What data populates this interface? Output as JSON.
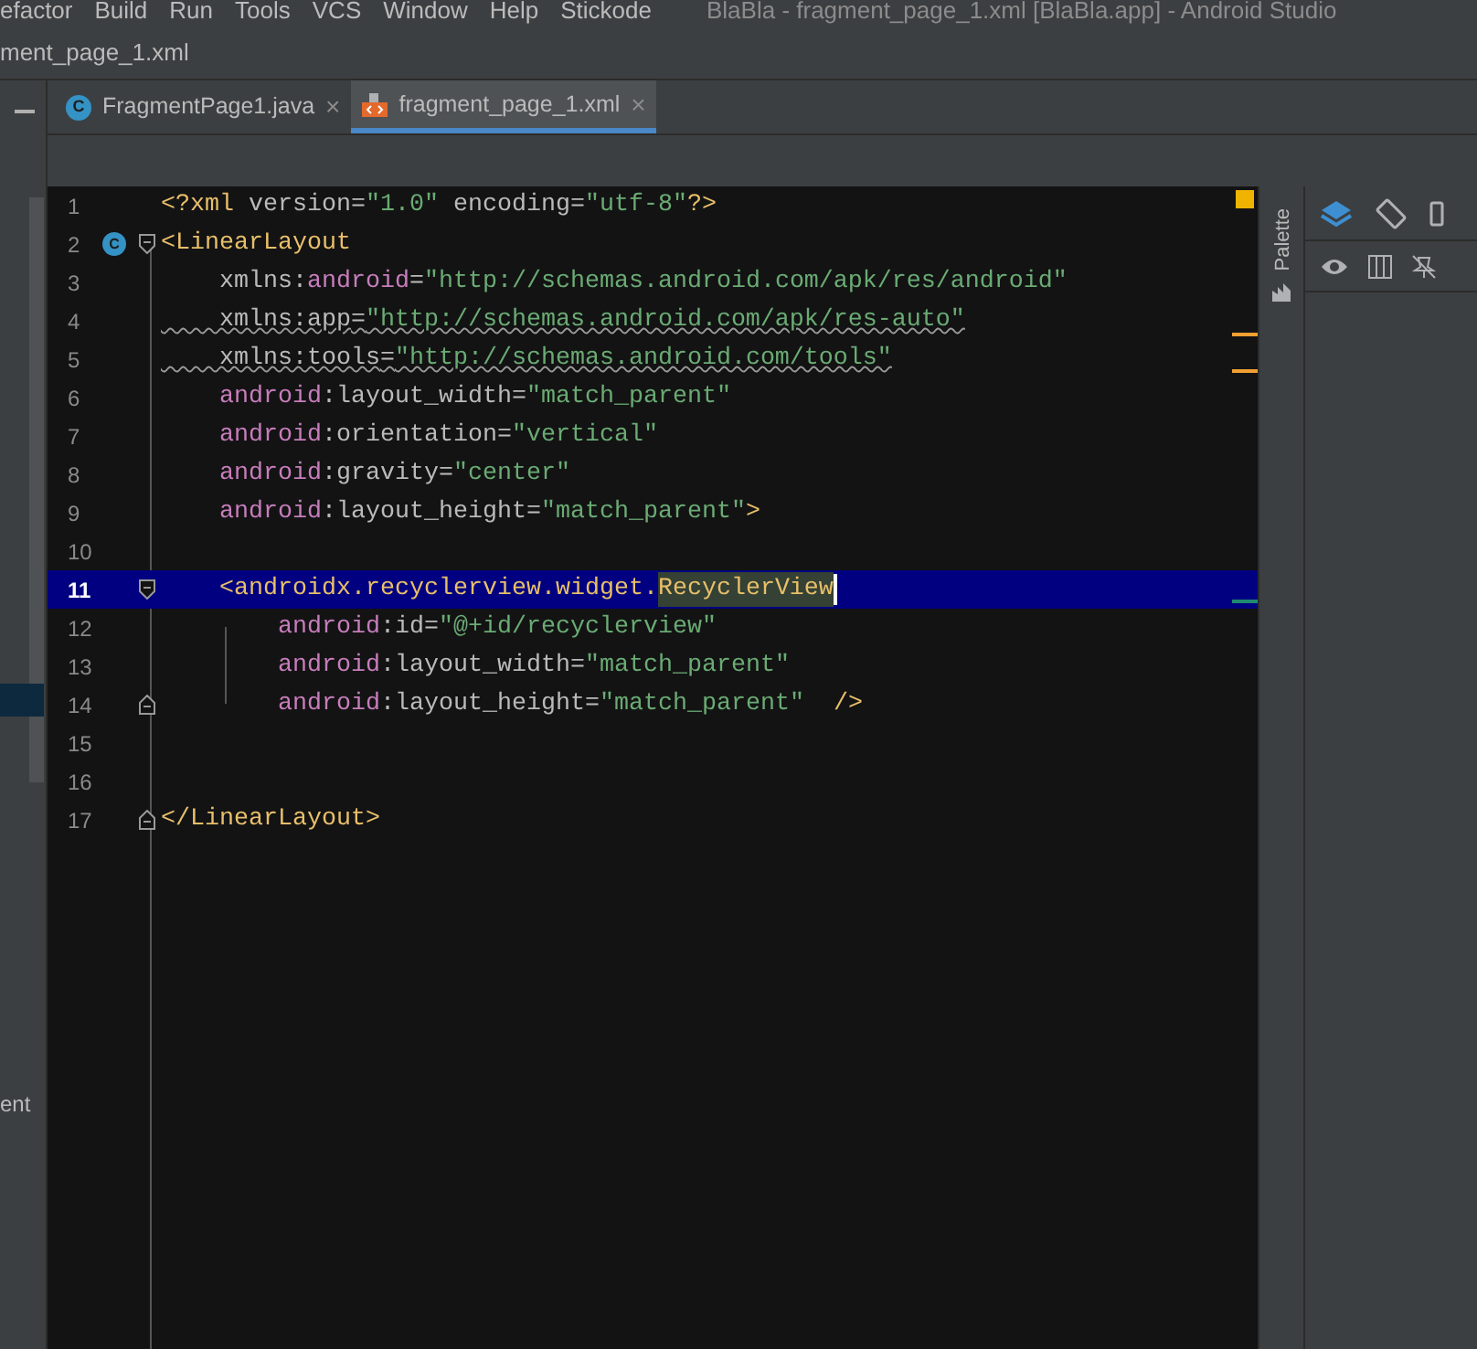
{
  "menu_bar": {
    "items": [
      "efactor",
      "Build",
      "Run",
      "Tools",
      "VCS",
      "Window",
      "Help",
      "Stickode"
    ],
    "title": "BlaBla - fragment_page_1.xml [BlaBla.app] - Android Studio"
  },
  "breadcrumb": "ment_page_1.xml",
  "project_panel": {
    "item_label": "ent"
  },
  "tabs": [
    {
      "label": "FragmentPage1.java",
      "kind": "java",
      "icon_letter": "C",
      "close": "×",
      "selected": false
    },
    {
      "label": "fragment_page_1.xml",
      "kind": "xml",
      "close": "×",
      "selected": true
    }
  ],
  "editor": {
    "lines": [
      {
        "number": "1",
        "current": false,
        "tokens": [
          {
            "kind": "tag",
            "text": "<?xml "
          },
          {
            "kind": "attr",
            "text": "version"
          },
          {
            "kind": "plain",
            "text": "="
          },
          {
            "kind": "value",
            "text": "\"1.0\""
          },
          {
            "kind": "attr",
            "text": " encoding"
          },
          {
            "kind": "plain",
            "text": "="
          },
          {
            "kind": "value",
            "text": "\"utf-8\""
          },
          {
            "kind": "tag",
            "text": "?>"
          }
        ]
      },
      {
        "number": "2",
        "current": false,
        "fold_start": true,
        "gutter_badge": "C",
        "tokens": [
          {
            "kind": "tag",
            "text": "<LinearLayout"
          }
        ]
      },
      {
        "number": "3",
        "current": false,
        "tokens": [
          {
            "kind": "attr",
            "text": "    xmlns:"
          },
          {
            "kind": "ns",
            "text": "android"
          },
          {
            "kind": "plain",
            "text": "="
          },
          {
            "kind": "value",
            "text": "\"http://schemas.android.com/apk/res/android\""
          }
        ]
      },
      {
        "number": "4",
        "current": false,
        "warning": true,
        "tokens": [
          {
            "kind": "attr",
            "text": "    xmlns:app"
          },
          {
            "kind": "plain",
            "text": "="
          },
          {
            "kind": "value",
            "text": "\"http://schemas.android.com/apk/res-auto\""
          }
        ]
      },
      {
        "number": "5",
        "current": false,
        "warning": true,
        "tokens": [
          {
            "kind": "attr",
            "text": "    xmlns:tools"
          },
          {
            "kind": "plain",
            "text": "="
          },
          {
            "kind": "value",
            "text": "\"http://schemas.android.com/tools\""
          }
        ]
      },
      {
        "number": "6",
        "current": false,
        "tokens": [
          {
            "kind": "ns",
            "text": "    android"
          },
          {
            "kind": "attr",
            "text": ":layout_width"
          },
          {
            "kind": "plain",
            "text": "="
          },
          {
            "kind": "value",
            "text": "\"match_parent\""
          }
        ]
      },
      {
        "number": "7",
        "current": false,
        "tokens": [
          {
            "kind": "ns",
            "text": "    android"
          },
          {
            "kind": "attr",
            "text": ":orientation"
          },
          {
            "kind": "plain",
            "text": "="
          },
          {
            "kind": "value",
            "text": "\"vertical\""
          }
        ]
      },
      {
        "number": "8",
        "current": false,
        "tokens": [
          {
            "kind": "ns",
            "text": "    android"
          },
          {
            "kind": "attr",
            "text": ":gravity"
          },
          {
            "kind": "plain",
            "text": "="
          },
          {
            "kind": "value",
            "text": "\"center\""
          }
        ]
      },
      {
        "number": "9",
        "current": false,
        "tokens": [
          {
            "kind": "ns",
            "text": "    android"
          },
          {
            "kind": "attr",
            "text": ":layout_height"
          },
          {
            "kind": "plain",
            "text": "="
          },
          {
            "kind": "value",
            "text": "\"match_parent\""
          },
          {
            "kind": "tag",
            "text": ">"
          }
        ]
      },
      {
        "number": "10",
        "current": false
      },
      {
        "number": "11",
        "current": true,
        "fold_start": true,
        "tokens": [
          {
            "kind": "tag",
            "text": "    <androidx.recyclerview.widget."
          },
          {
            "kind": "match",
            "text": "RecyclerView"
          }
        ]
      },
      {
        "number": "12",
        "current": false,
        "tokens": [
          {
            "kind": "ns",
            "text": "        android"
          },
          {
            "kind": "attr",
            "text": ":id"
          },
          {
            "kind": "plain",
            "text": "="
          },
          {
            "kind": "value",
            "text": "\"@+id/recyclerview\""
          }
        ]
      },
      {
        "number": "13",
        "current": false,
        "tokens": [
          {
            "kind": "ns",
            "text": "        android"
          },
          {
            "kind": "attr",
            "text": ":layout_width"
          },
          {
            "kind": "plain",
            "text": "="
          },
          {
            "kind": "value",
            "text": "\"match_parent\""
          }
        ]
      },
      {
        "number": "14",
        "current": false,
        "fold_end": true,
        "tokens": [
          {
            "kind": "ns",
            "text": "        android"
          },
          {
            "kind": "attr",
            "text": ":layout_height"
          },
          {
            "kind": "plain",
            "text": "="
          },
          {
            "kind": "value",
            "text": "\"match_parent\""
          },
          {
            "kind": "tag",
            "text": "  />"
          }
        ]
      },
      {
        "number": "15",
        "current": false
      },
      {
        "number": "16",
        "current": false
      },
      {
        "number": "17",
        "current": false,
        "fold_end": true,
        "tokens": [
          {
            "kind": "tag",
            "text": "</LinearLayout>"
          }
        ]
      }
    ]
  },
  "palette": {
    "label": "Palette"
  }
}
